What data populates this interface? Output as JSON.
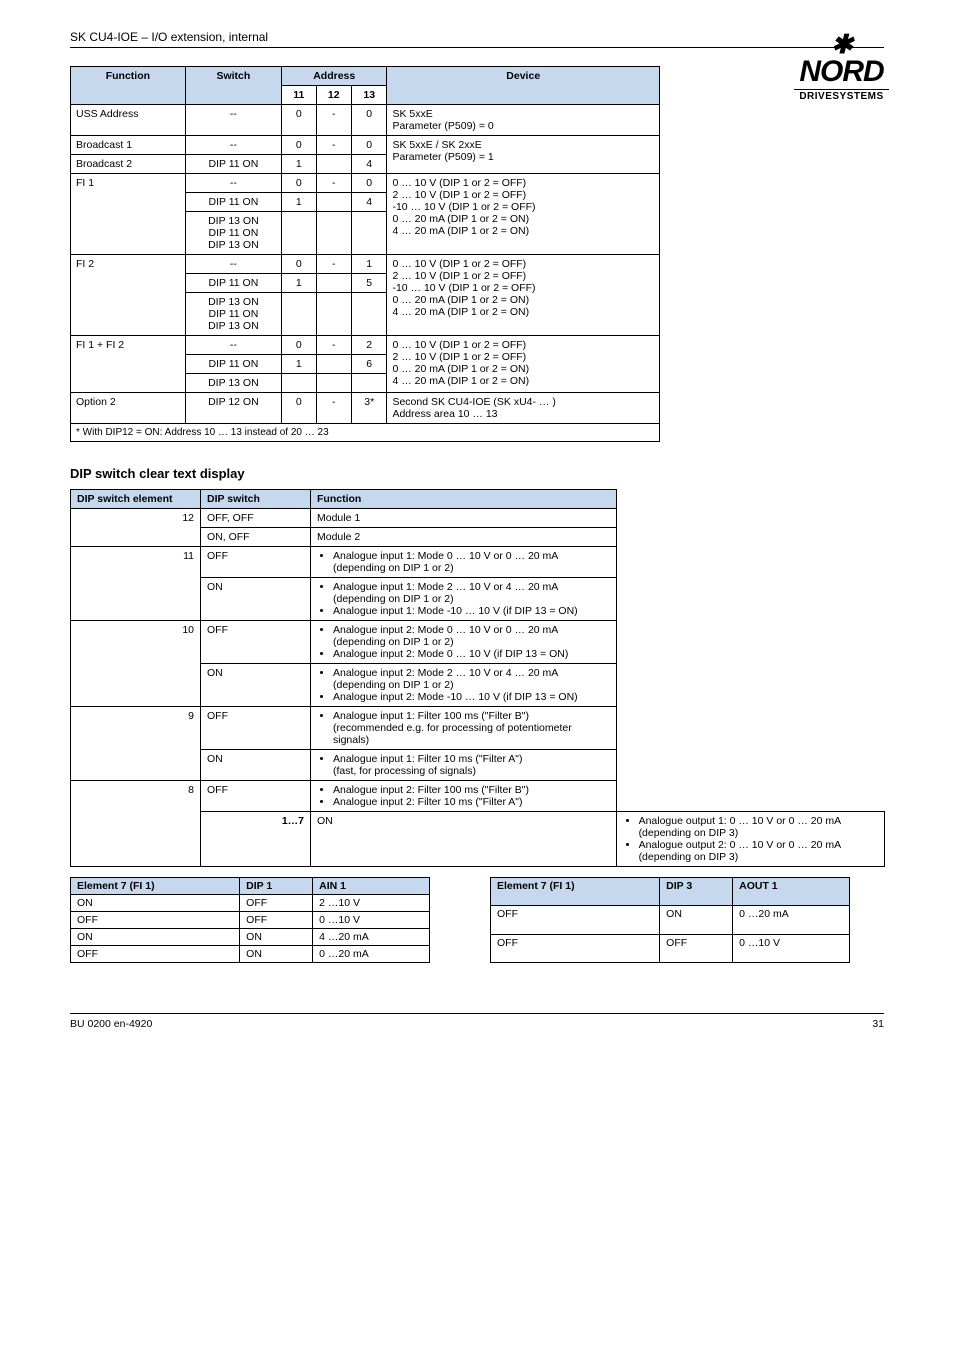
{
  "doc_header": "SK CU4-IOE – I/O extension, internal",
  "logo": {
    "brand_top_pre": "N",
    "brand_top_main": "ORD",
    "brand_sub": "DRIVESYSTEMS"
  },
  "t1": {
    "headers": {
      "function": "Function",
      "switch": "Switch",
      "address": "Address",
      "device": "Device",
      "c1": "11",
      "c2": "12",
      "c3": "13"
    },
    "rows": [
      {
        "func": "USS Address",
        "switch": "--",
        "a": "0",
        "b": "-",
        "c": "0",
        "device": "SK 5xxE\nParameter (P509) = 0"
      },
      {
        "func": "Broadcast 1",
        "switch": "--",
        "a": "0",
        "b": "-",
        "c": "0",
        "device": "SK 5xxE / SK 2xxE\nParameter (P509) = 1",
        "extra_row": {
          "func": "Broadcast 2",
          "switch": "DIP 11 ON",
          "a": "1",
          "b": "",
          "c": "4"
        }
      },
      {
        "func": "FI 1",
        "switch": "--",
        "a": "0",
        "b": "-",
        "c": "0",
        "device": "0 … 10 V (DIP 1 or 2 = OFF)\n2 … 10 V (DIP 1 or 2 = OFF)\n-10 … 10 V (DIP 1 or 2 = OFF)\n0 … 20 mA (DIP 1 or 2 = ON)\n4 … 20 mA (DIP 1 or 2 = ON)",
        "extra_rows": [
          {
            "func": "",
            "switch": "DIP 11 ON",
            "a": "1",
            "b": "",
            "c": "4"
          },
          {
            "func": "",
            "switch": "DIP 13 ON\nDIP 11 ON\nDIP 13 ON",
            "a": "",
            "b": "",
            "c": ""
          }
        ]
      },
      {
        "func": "FI 2",
        "switch_cells": [
          "--",
          "DIP 11 ON",
          "DIP 13 ON\nDIP 11 ON\nDIP 13 ON"
        ],
        "addr": [
          [
            "0",
            "-",
            "1"
          ],
          [
            "1",
            "",
            "5"
          ],
          [
            "",
            "",
            ""
          ]
        ],
        "device": "0 … 10 V (DIP 1 or 2 = OFF)\n2 … 10 V (DIP 1 or 2 = OFF)\n-10 … 10 V (DIP 1 or 2 = OFF)\n0 … 20 mA (DIP 1 or 2 = ON)\n4 … 20 mA (DIP 1 or 2 = ON)"
      },
      {
        "func": "FI 1 + FI 2",
        "switch_cells": [
          "--",
          "DIP 11 ON",
          "DIP 13 ON"
        ],
        "addr": [
          [
            "0",
            "-",
            "2"
          ],
          [
            "1",
            "",
            "6"
          ],
          [
            "",
            "",
            ""
          ]
        ],
        "device": "0 … 10 V (DIP 1 or 2 = OFF)\n2 … 10 V (DIP 1 or 2 = OFF)\n0 … 20 mA (DIP 1 or 2 = ON)\n4 … 20 mA (DIP 1 or 2 = ON)"
      },
      {
        "func": "Option 2",
        "switch": "DIP 12 ON",
        "a": "0",
        "b": "-",
        "c": "3*",
        "device": "Second SK CU4-IOE (SK xU4- … )\nAddress area 10 … 13"
      }
    ],
    "footnote": "* With DIP12 = ON: Address 10 … 13 instead of 20 … 23"
  },
  "section_h": "DIP switch clear text display",
  "t2": {
    "headers": {
      "dip_el": "DIP switch element",
      "ds": "DIP switch",
      "function": "Function"
    },
    "rows": [
      {
        "el": "12",
        "ds": "OFF, OFF",
        "func": "Module 1"
      },
      {
        "el": "",
        "ds": "ON, OFF",
        "func": "Module 2"
      },
      {
        "el": "11",
        "ds": "OFF",
        "func_list": [
          "Analogue input 1: Mode 0 … 10 V or 0 … 20 mA (depending on DIP 1 or 2)"
        ]
      },
      {
        "el": "",
        "ds": "ON",
        "func_list": [
          "Analogue input 1: Mode 2 … 10 V or 4 … 20 mA (depending on DIP 1 or 2)",
          "Analogue input 1: Mode -10 … 10 V (if DIP 13 = ON)"
        ]
      },
      {
        "el": "10",
        "ds": "OFF",
        "func_list": [
          "Analogue input 2: Mode 0 … 10 V or 0 … 20 mA (depending on DIP 1 or 2)",
          "Analogue input 2: Mode 0 … 10 V (if DIP 13 = ON)"
        ]
      },
      {
        "el": "",
        "ds": "ON",
        "func_list": [
          "Analogue input 2: Mode 2 … 10 V or 4 … 20 mA (depending on DIP 1 or 2)",
          "Analogue input 2: Mode -10 … 10 V (if DIP 13 = ON)"
        ]
      },
      {
        "el": "9",
        "ds": "OFF",
        "func_list": [
          "Analogue input 1: Filter 100 ms (\"Filter B\")\n(recommended e.g. for processing of potentiometer signals)"
        ]
      },
      {
        "el": "",
        "ds": "ON",
        "func_list": [
          "Analogue input 1: Filter 10 ms (\"Filter A\")\n(fast, for processing of signals)"
        ]
      },
      {
        "el": "8",
        "ds": "OFF",
        "func_list": [
          "Analogue input 2: Filter 100 ms (\"Filter B\")",
          "Analogue input 2: Filter 10 ms (\"Filter A\")"
        ]
      },
      {
        "el": "",
        "ds": "ON",
        "func_list": [
          "Analogue output 1: 0 … 10 V or 0 … 20 mA (depending on DIP 3)",
          "Analogue output 2: 0 … 10 V or 0 … 20 mA (depending on DIP 3)"
        ],
        "bold_17": "1…7"
      }
    ]
  },
  "t3": {
    "headers": {
      "a": "Element 7 (FI 1)",
      "b": "DIP 1",
      "c": "AIN 1"
    },
    "rows": [
      {
        "a": "ON",
        "b": "OFF",
        "c": "2 …10 V"
      },
      {
        "a": "OFF",
        "b": "OFF",
        "c": "0 …10 V"
      },
      {
        "a": "ON",
        "b": "ON",
        "c": "4 …20 mA"
      },
      {
        "a": "OFF",
        "b": "ON",
        "c": "0 …20 mA"
      }
    ]
  },
  "t4": {
    "headers": {
      "a": "Element 7 (FI 1)",
      "b": "DIP 3",
      "c": "AOUT 1"
    },
    "rows": [
      {
        "a": "OFF",
        "b": "ON",
        "c": "0 …20 mA"
      },
      {
        "a": "OFF",
        "b": "OFF",
        "c": "0 …10 V"
      }
    ]
  },
  "footer": {
    "left": "BU 0200 en-4920",
    "right": "31"
  }
}
